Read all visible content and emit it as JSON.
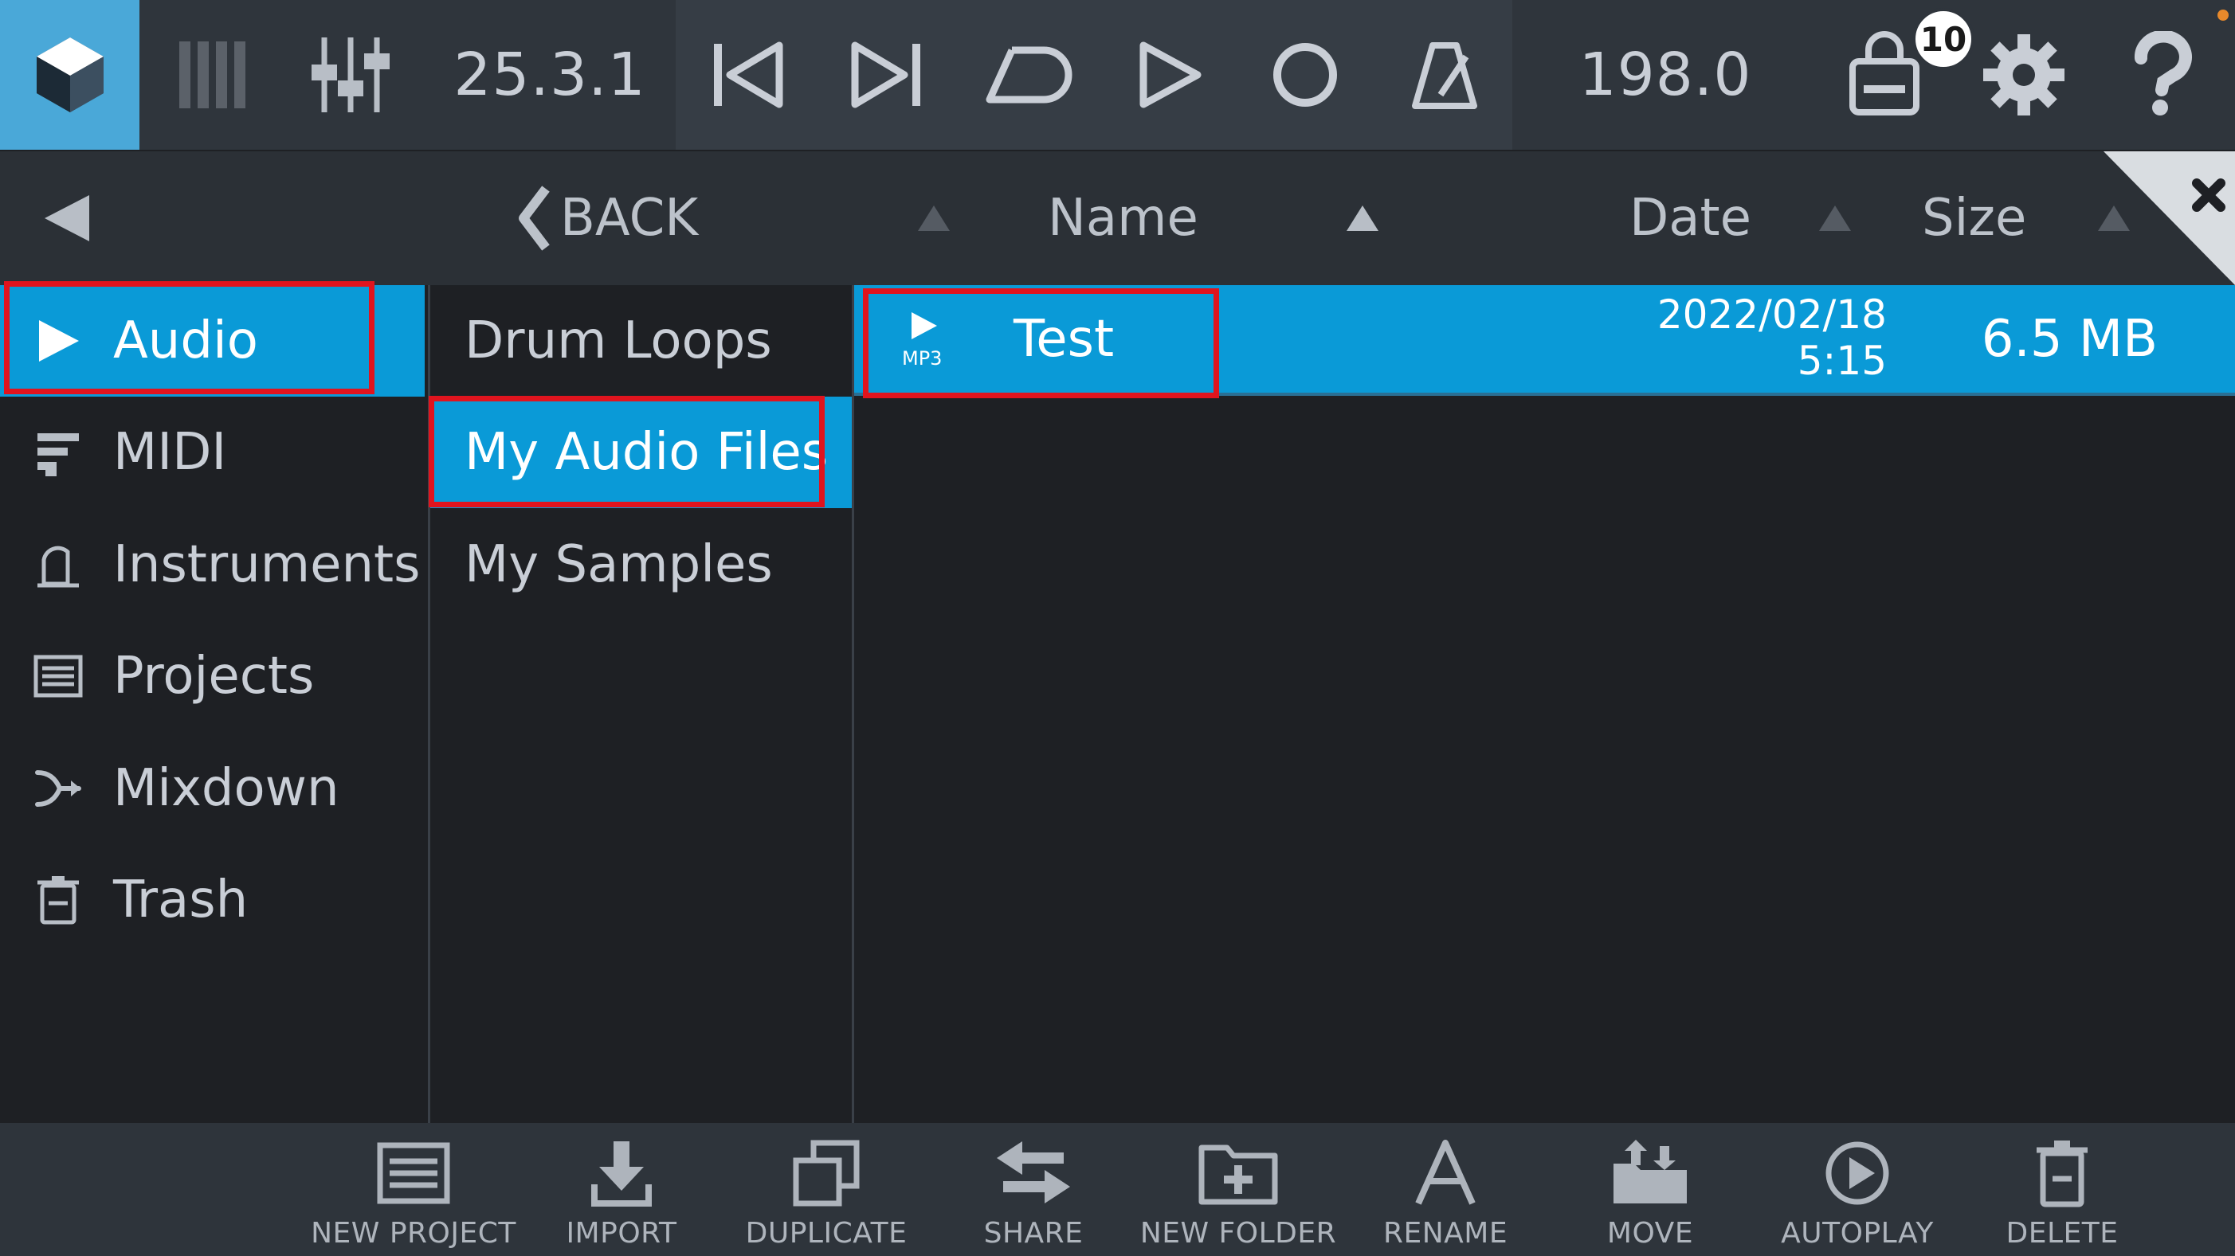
{
  "toolbar": {
    "position": "25.3.1",
    "tempo": "198.0",
    "store_badge": "10"
  },
  "header": {
    "back_label": "BACK",
    "columns": {
      "name": "Name",
      "date": "Date",
      "size": "Size"
    }
  },
  "categories": [
    {
      "label": "Audio",
      "icon": "play-icon",
      "selected": true
    },
    {
      "label": "MIDI",
      "icon": "midi-icon",
      "selected": false
    },
    {
      "label": "Instruments",
      "icon": "instrument-icon",
      "selected": false
    },
    {
      "label": "Projects",
      "icon": "projects-icon",
      "selected": false
    },
    {
      "label": "Mixdown",
      "icon": "mixdown-icon",
      "selected": false
    },
    {
      "label": "Trash",
      "icon": "trash-icon",
      "selected": false
    }
  ],
  "folders": [
    {
      "label": "Drum Loops",
      "selected": false
    },
    {
      "label": "My Audio Files",
      "selected": true
    },
    {
      "label": "My Samples",
      "selected": false
    }
  ],
  "files": [
    {
      "type_label": "MP3",
      "name": "Test",
      "date_line1": "2022/02/18",
      "date_line2": "5:15",
      "size": "6.5 MB"
    }
  ],
  "bottom_actions": [
    {
      "label": "NEW PROJECT",
      "icon": "new-project-icon"
    },
    {
      "label": "IMPORT",
      "icon": "import-icon"
    },
    {
      "label": "DUPLICATE",
      "icon": "duplicate-icon"
    },
    {
      "label": "SHARE",
      "icon": "share-icon"
    },
    {
      "label": "NEW FOLDER",
      "icon": "new-folder-icon"
    },
    {
      "label": "RENAME",
      "icon": "rename-icon"
    },
    {
      "label": "MOVE",
      "icon": "move-icon"
    },
    {
      "label": "AUTOPLAY",
      "icon": "autoplay-icon"
    },
    {
      "label": "DELETE",
      "icon": "delete-icon"
    }
  ],
  "colors": {
    "accent": "#0a9ad7",
    "logo_bg": "#4aa8d8",
    "highlight_box": "#e0141e",
    "background": "#1e2024",
    "toolbar": "#2f353c"
  }
}
